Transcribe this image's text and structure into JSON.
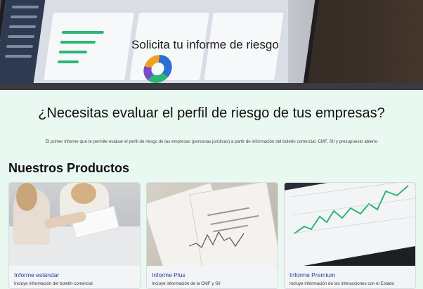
{
  "hero": {
    "title": "Solicita tu informe de riesgo"
  },
  "section": {
    "headline": "¿Necesitas evaluar el perfil de riesgo de tus empresas?",
    "intro": "El primer informe que te permite evaluar el perfil de riesgo de las empresas (personas jurídicas) a partir de información del boletín comercial, CMF, SII y presupuesto abierto"
  },
  "products": {
    "title": "Nuestros Productos",
    "items": [
      {
        "name": "Informe estándar",
        "desc": "Incluye información del boletín comercial"
      },
      {
        "name": "Informe Plus",
        "desc": "Incluye información de la CMF y SII"
      },
      {
        "name": "Informe Premium",
        "desc": "Incluye información de las interacciones con el Estado"
      }
    ]
  },
  "colors": {
    "background": "#e9f8f1",
    "link": "#1f3fa8",
    "chart_line": "#2bb673"
  }
}
